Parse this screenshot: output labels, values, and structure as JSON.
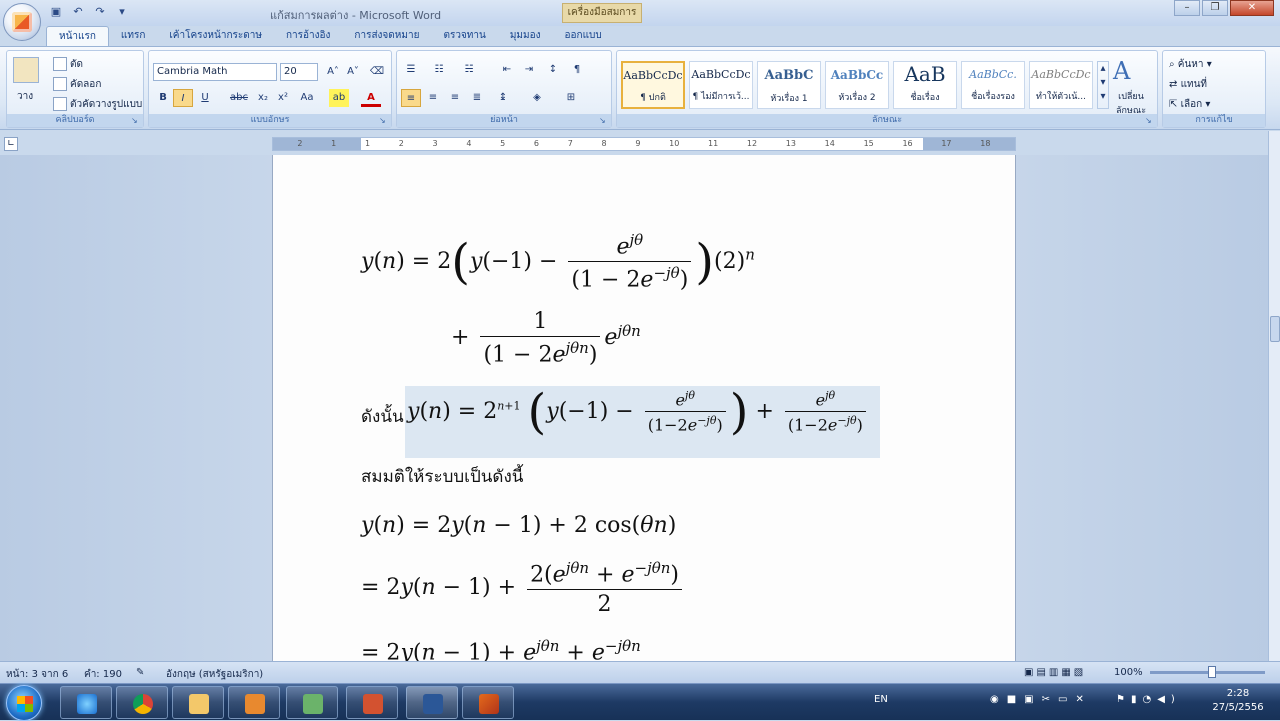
{
  "titlebar": {
    "title": "แก้สมการผลต่าง - Microsoft Word",
    "contextual_tab": "เครื่องมือสมการ",
    "minimize": "–",
    "restore": "❐",
    "close": "✕"
  },
  "tabs": [
    "หน้าแรก",
    "แทรก",
    "เค้าโครงหน้ากระดาษ",
    "การอ้างอิง",
    "การส่งจดหมาย",
    "ตรวจทาน",
    "มุมมอง",
    "ออกแบบ"
  ],
  "clipboard": {
    "paste": "วาง",
    "cut": "ตัด",
    "copy": "คัดลอก",
    "format_painter": "ตัวคัดวางรูปแบบ",
    "label": "คลิปบอร์ด"
  },
  "font": {
    "name": "Cambria Math",
    "size": "20",
    "label": "แบบอักษร"
  },
  "paragraph": {
    "label": "ย่อหน้า"
  },
  "styles": {
    "items": [
      {
        "sample": "AaBbCcDc",
        "name": "¶ ปกติ"
      },
      {
        "sample": "AaBbCcDc",
        "name": "¶ ไม่มีการเว้..."
      },
      {
        "sample": "AaBbC",
        "name": "หัวเรื่อง 1"
      },
      {
        "sample": "AaBbCc",
        "name": "หัวเรื่อง 2"
      },
      {
        "sample": "AaB",
        "name": "ชื่อเรื่อง"
      },
      {
        "sample": "AaBbCc.",
        "name": "ชื่อเรื่องรอง"
      },
      {
        "sample": "AaBbCcDc",
        "name": "ทำให้ตัวเน้..."
      }
    ],
    "change": "เปลี่ยน ลักษณะ",
    "label": "ลักษณะ"
  },
  "editing": {
    "find": "ค้นหา",
    "replace": "แทนที่",
    "select": "เลือก",
    "label": "การแก้ไข"
  },
  "ruler": [
    "2",
    "1",
    "1",
    "2",
    "3",
    "4",
    "5",
    "6",
    "7",
    "8",
    "9",
    "10",
    "11",
    "12",
    "13",
    "14",
    "15",
    "16",
    "17",
    "18"
  ],
  "document": {
    "therefore": "ดังนั้น",
    "assume": "สมมติให้ระบบเป็นดังนี้"
  },
  "statusbar": {
    "page": "หน้า: 3 จาก 6",
    "words": "คำ: 190",
    "language": "อังกฤษ (สหรัฐอเมริกา)",
    "zoom": "100%"
  },
  "taskbar": {
    "lang": "EN",
    "time": "2:28",
    "date": "27/5/2556"
  }
}
